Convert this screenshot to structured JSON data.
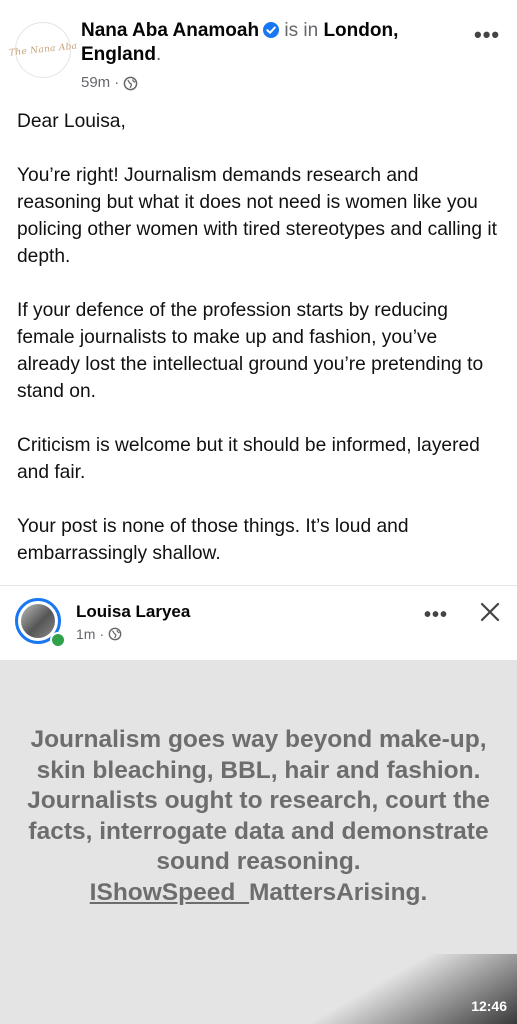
{
  "post": {
    "avatar_text": "The Nana Aba",
    "author_name": "Nana Aba Anamoah",
    "is_in": "is in",
    "location": "London, England",
    "location_period": ".",
    "time": "59m",
    "separator": "·",
    "privacy_icon": "globe-icon",
    "more_icon": "more-options-icon",
    "paragraphs": [
      "Dear Louisa,",
      "You’re right! Journalism demands research and reasoning but what it does not need is women like you policing other women with tired stereotypes and calling it depth.",
      "If your defence of the profession starts by reducing female journalists to make up and fashion, you’ve already lost the intellectual ground you’re pretending to stand on.",
      "Criticism is welcome but it should be informed, layered and fair.",
      "Your post is none of those things. It’s loud and embarrassingly shallow."
    ]
  },
  "shared_story": {
    "author_name": "Louisa Laryea",
    "time": "1m",
    "separator": "·",
    "text_main": "Journalism goes way beyond make-up, skin bleaching, BBL, hair and fashion. Journalists ought to research, court the facts, interrogate data and demonstrate sound reasoning.",
    "hashtag_underlined": "IShowSpeed_",
    "hashtag_rest": "MattersArising."
  },
  "status_bar": {
    "clock": "12:46"
  },
  "colors": {
    "verified_blue": "#1877f2",
    "online_green": "#31a24c",
    "story_background": "#e4e4e4",
    "story_text": "#6d6d6d"
  }
}
